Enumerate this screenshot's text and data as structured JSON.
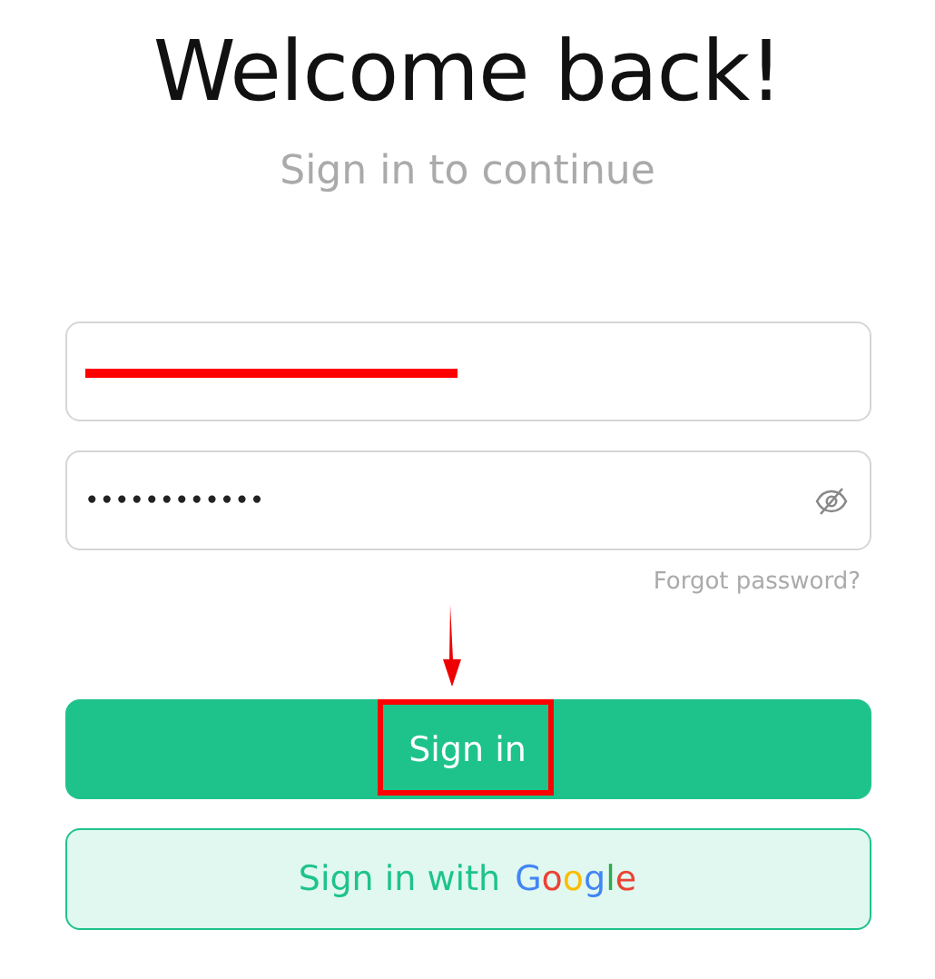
{
  "title": "Welcome back!",
  "subtitle": "Sign in to continue",
  "email": {
    "redacted": true
  },
  "password": {
    "value": "••••••••••••",
    "visible": false
  },
  "forgot_link": "Forgot password?",
  "sign_in_button": {
    "label": "Sign in",
    "highlighted": true
  },
  "google_button": {
    "label": "Sign in with",
    "brand": "Google"
  },
  "annotations": {
    "arrow": true
  }
}
